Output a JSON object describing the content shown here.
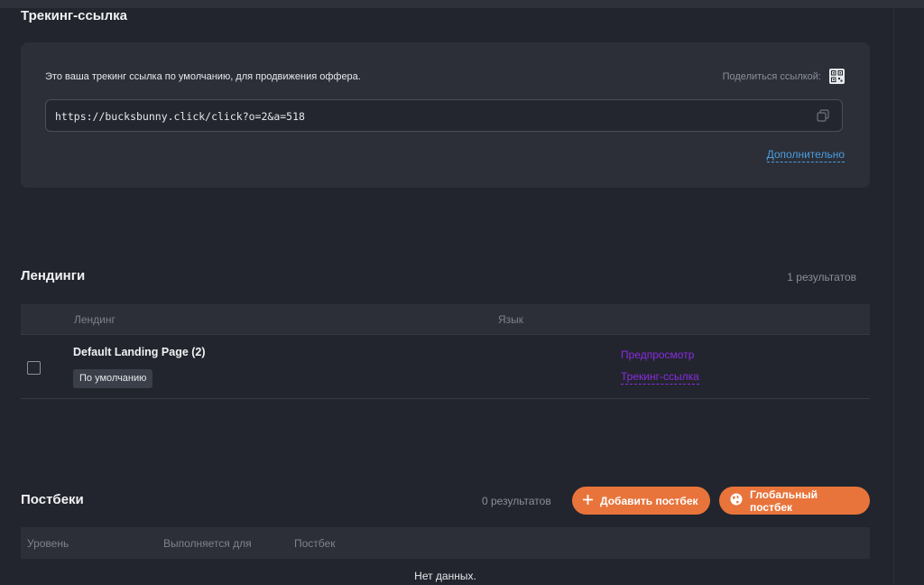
{
  "tracking": {
    "title": "Трекинг-ссылка",
    "description": "Это ваша трекинг ссылка по умолчанию, для продвижения оффера.",
    "share_label": "Поделиться ссылкой:",
    "url": "https://bucksbunny.click/click?o=2&a=518",
    "more_link": "Дополнительно"
  },
  "landings": {
    "title": "Лендинги",
    "results": "1 результатов",
    "columns": [
      "Лендинг",
      "Язык"
    ],
    "rows": [
      {
        "name": "Default Landing Page (2)",
        "badge": "По умолчанию",
        "preview_link": "Предпросмотр",
        "tracking_link": "Трекинг-ссылка"
      }
    ]
  },
  "postbacks": {
    "title": "Постбеки",
    "results": "0 результатов",
    "add_button": "Добавить постбек",
    "global_button": "Глобальный постбек",
    "columns": [
      "Уровень",
      "Выполняется для",
      "Постбек"
    ],
    "empty_text": "Нет данных."
  },
  "colors": {
    "background": "#22252d",
    "card": "#2c2f38",
    "accent_orange": "#e8743b",
    "link_blue": "#4a9ee0",
    "link_purple": "#8a2be2"
  },
  "icons": {
    "qr": "qr-code-icon",
    "copy": "copy-icon",
    "plus": "plus-icon",
    "globe": "globe-icon"
  }
}
